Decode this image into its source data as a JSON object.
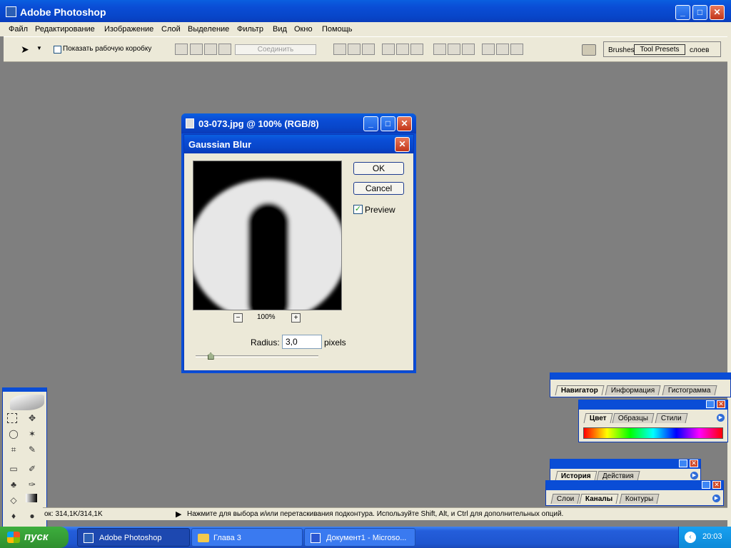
{
  "app": {
    "title": "Adobe Photoshop"
  },
  "menu": [
    "Файл",
    "Редактирование",
    "Изображение",
    "Слой",
    "Выделение",
    "Фильтр",
    "Вид",
    "Окно",
    "Помощь"
  ],
  "options": {
    "show_bounding_box": "Показать рабочую коробку",
    "combine_button": "Соединить",
    "well_tabs": [
      "Brushes",
      "Tool Presets",
      "слоев"
    ]
  },
  "document": {
    "title": "03-073.jpg @ 100% (RGB/8)"
  },
  "dialog": {
    "title": "Gaussian Blur",
    "ok": "OK",
    "cancel": "Cancel",
    "preview_label": "Preview",
    "preview_checked": true,
    "zoom_minus": "−",
    "zoom_value": "100%",
    "zoom_plus": "+",
    "radius_label": "Radius:",
    "radius_value": "3,0",
    "radius_unit": "pixels",
    "slider_fraction": 0.12
  },
  "panels": {
    "navigator": [
      "Навигатор",
      "Информация",
      "Гистограмма"
    ],
    "color": [
      "Цвет",
      "Образцы",
      "Стили"
    ],
    "history": [
      "История",
      "Действия"
    ],
    "layers": [
      "Слои",
      "Каналы",
      "Контуры"
    ]
  },
  "status": {
    "doc_size": "ок: 314,1K/314,1K",
    "hint": "Нажмите для выбора и/или перетаскивания подконтура. Используйте Shift, Alt, и Ctrl для дополнительных опций."
  },
  "taskbar": {
    "start": "пуск",
    "items": [
      "Adobe Photoshop",
      "Глава 3",
      "Документ1 - Microso..."
    ],
    "clock": "20:03"
  },
  "colors": {
    "xp_blue": "#0a4dd6",
    "panel_bg": "#ece9d8",
    "taskbar_green": "#3c9a3c"
  }
}
